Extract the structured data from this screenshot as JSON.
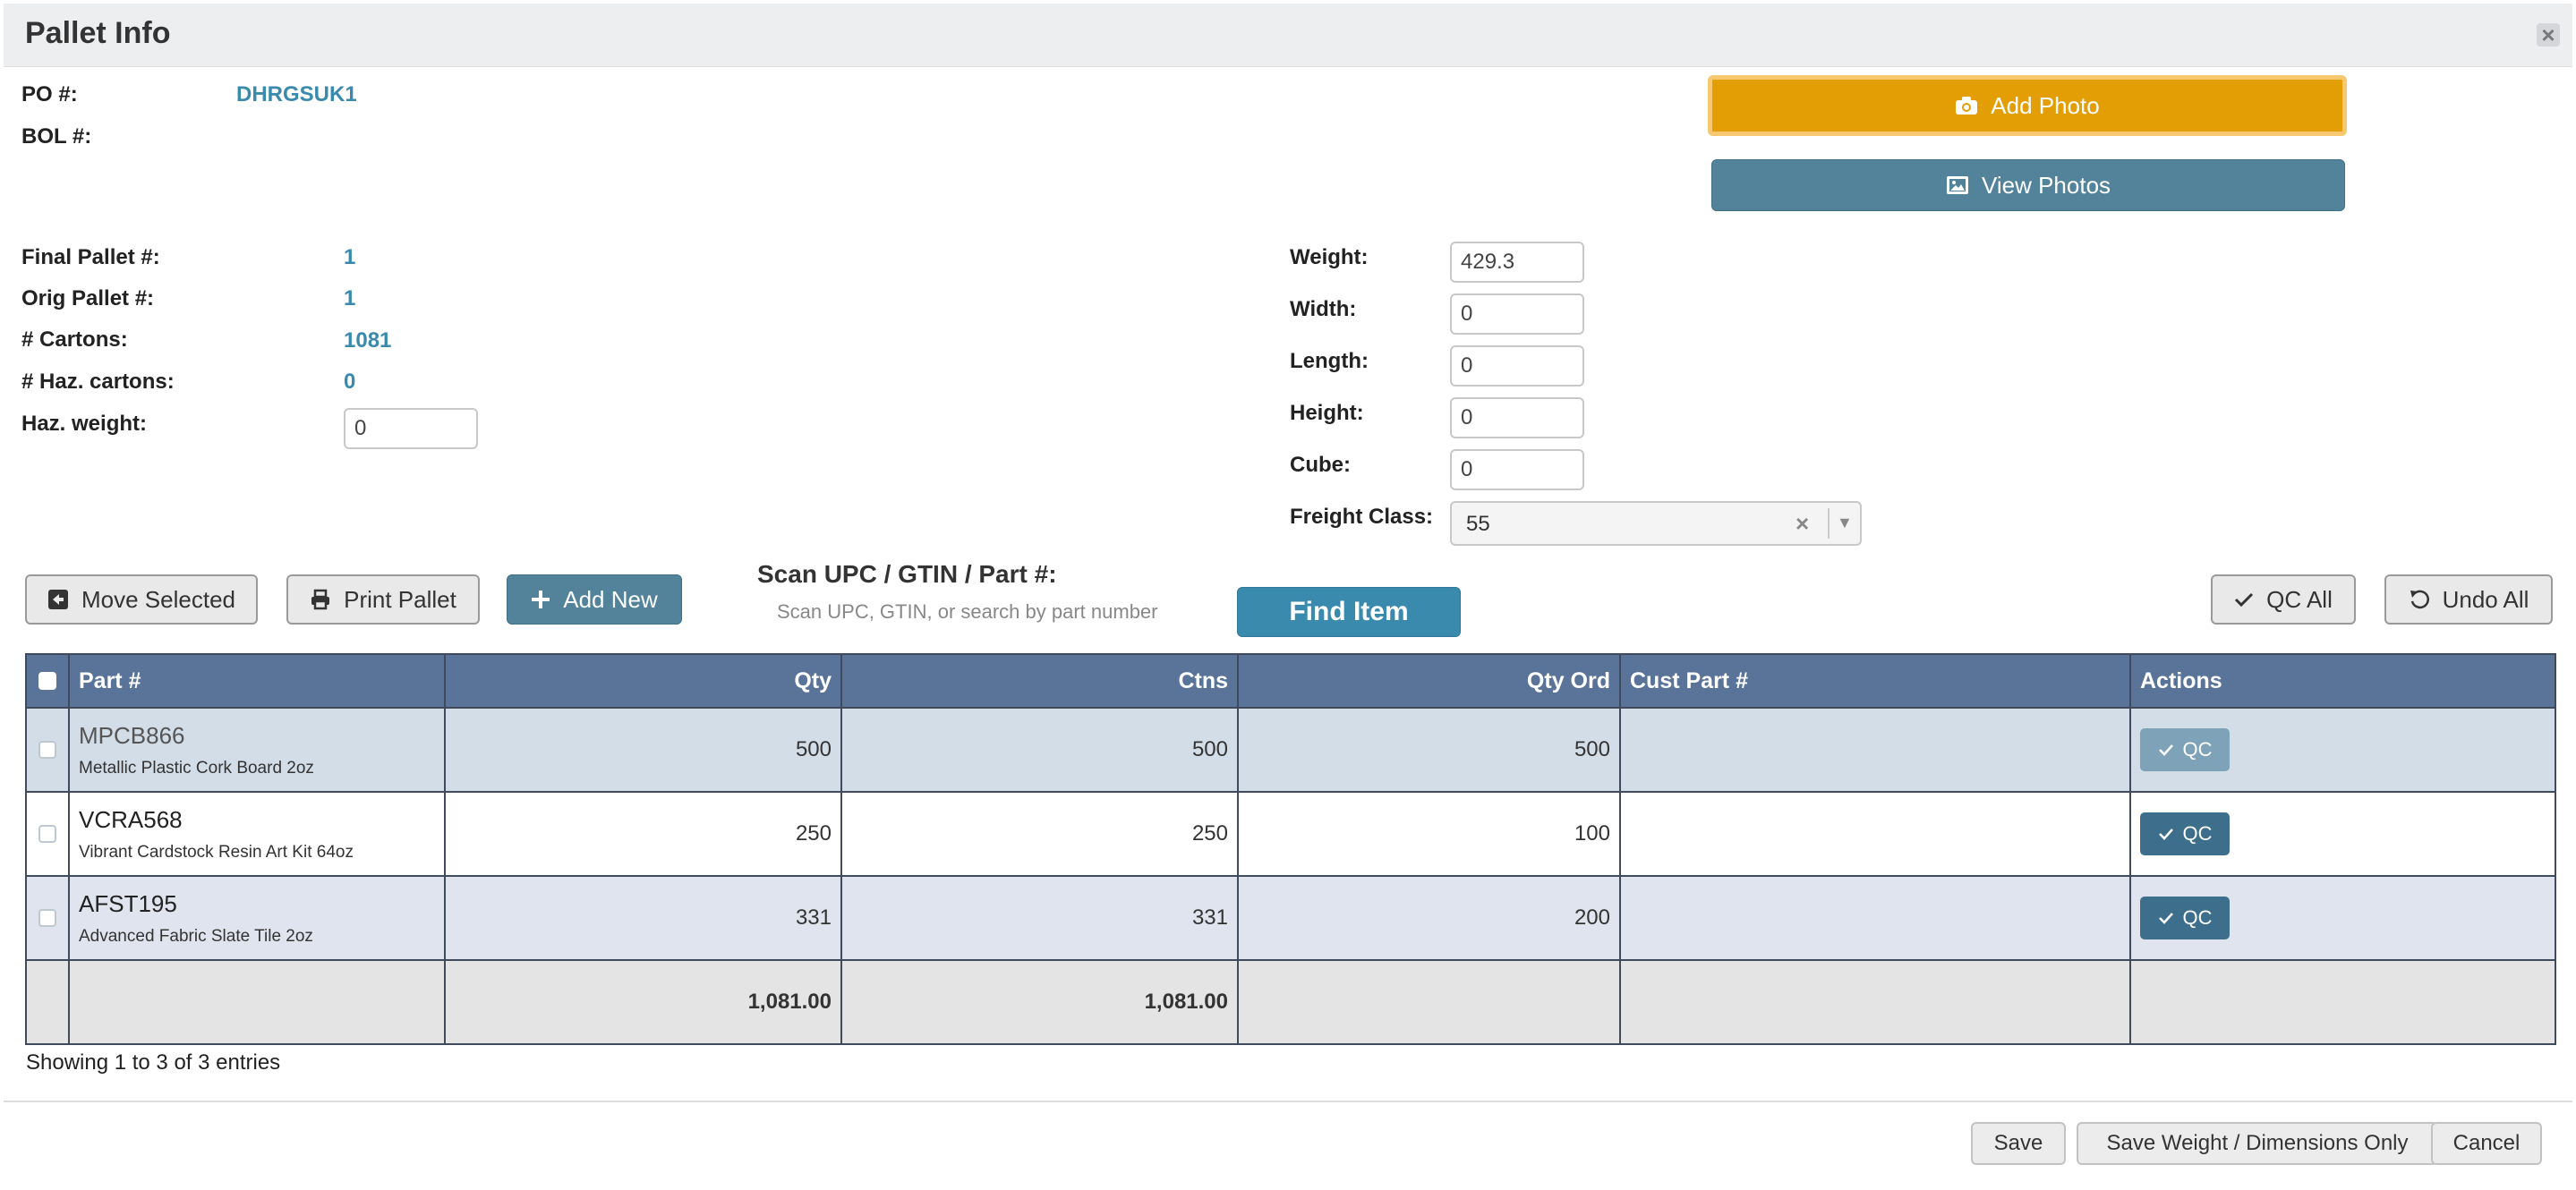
{
  "dialog": {
    "title": "Pallet Info",
    "close_glyph": "×"
  },
  "info": {
    "po_label": "PO #:",
    "po_value": "DHRGSUK1",
    "bol_label": "BOL #:",
    "bol_value": ""
  },
  "photos": {
    "add_label": "Add Photo",
    "view_label": "View Photos"
  },
  "pallet": {
    "final_label": "Final Pallet #:",
    "final_value": "1",
    "orig_label": "Orig Pallet #:",
    "orig_value": "1",
    "cartons_label": "# Cartons:",
    "cartons_value": "1081",
    "haz_cartons_label": "# Haz. cartons:",
    "haz_cartons_value": "0",
    "haz_weight_label": "Haz. weight:",
    "haz_weight_value": "0"
  },
  "dimensions": {
    "weight_label": "Weight:",
    "weight_value": "429.3",
    "width_label": "Width:",
    "width_value": "0",
    "length_label": "Length:",
    "length_value": "0",
    "height_label": "Height:",
    "height_value": "0",
    "cube_label": "Cube:",
    "cube_value": "0",
    "freight_label": "Freight Class:",
    "freight_value": "55"
  },
  "toolbar": {
    "move_label": "Move Selected",
    "print_label": "Print Pallet",
    "add_new_label": "Add New",
    "scan_label": "Scan UPC / GTIN / Part #:",
    "scan_placeholder": "Scan UPC, GTIN, or search by part number",
    "find_label": "Find Item",
    "qc_all_label": "QC All",
    "undo_all_label": "Undo All"
  },
  "table": {
    "headers": {
      "part": "Part #",
      "qty": "Qty",
      "ctns": "Ctns",
      "qty_ord": "Qty Ord",
      "cust_part": "Cust Part #",
      "actions": "Actions"
    },
    "rows": [
      {
        "part": "MPCB866",
        "desc": "Metallic Plastic Cork Board 2oz",
        "qty": "500",
        "ctns": "500",
        "qty_ord": "500",
        "cust_part": "",
        "qc_label": "QC"
      },
      {
        "part": "VCRA568",
        "desc": "Vibrant Cardstock Resin Art Kit 64oz",
        "qty": "250",
        "ctns": "250",
        "qty_ord": "100",
        "cust_part": "",
        "qc_label": "QC"
      },
      {
        "part": "AFST195",
        "desc": "Advanced Fabric Slate Tile 2oz",
        "qty": "331",
        "ctns": "331",
        "qty_ord": "200",
        "cust_part": "",
        "qc_label": "QC"
      }
    ],
    "totals": {
      "qty": "1,081.00",
      "ctns": "1,081.00"
    }
  },
  "footer": {
    "showing": "Showing 1 to 3 of 3 entries",
    "save_label": "Save",
    "save_dims_label": "Save Weight / Dimensions Only",
    "cancel_label": "Cancel"
  },
  "colors": {
    "add_photo": "#e49e05",
    "view_photos": "#52839b",
    "find_item": "#3a8aad",
    "table_header": "#5a7499",
    "value_text": "#3a8aad",
    "qc_button": "#3d6f8c"
  },
  "icons": {
    "add_photo": "camera-icon",
    "view_photos": "image-icon",
    "move": "move-left-icon",
    "print": "printer-icon",
    "add_new": "plus-icon",
    "qc": "check-icon",
    "undo": "undo-icon",
    "close": "close-icon"
  }
}
